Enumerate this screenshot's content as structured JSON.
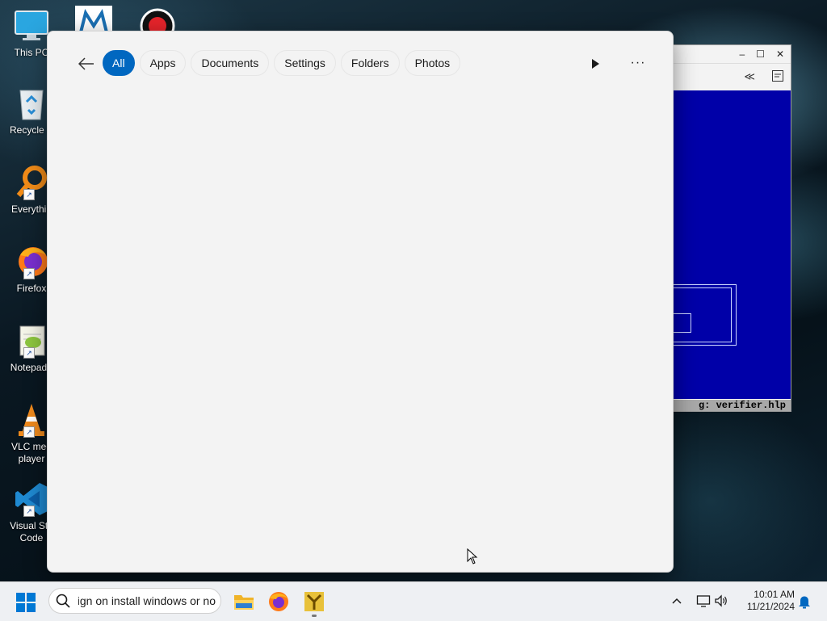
{
  "desktop": {
    "icons": [
      {
        "label": "This PC"
      },
      {
        "label": "Recycle B"
      },
      {
        "label": "Everythin"
      },
      {
        "label": "Firefox"
      },
      {
        "label": "Notepad+"
      },
      {
        "label_line1": "VLC med",
        "label_line2": "player"
      },
      {
        "label_line1": "Visual Stu",
        "label_line2": "Code"
      }
    ]
  },
  "background_window": {
    "minimize": "–",
    "maximize": "☐",
    "close": "✕",
    "status_text": "g: verifier.hlp"
  },
  "search_panel": {
    "filters": [
      {
        "label": "All",
        "active": true
      },
      {
        "label": "Apps"
      },
      {
        "label": "Documents"
      },
      {
        "label": "Settings"
      },
      {
        "label": "Folders"
      },
      {
        "label": "Photos"
      }
    ],
    "more_label": "···"
  },
  "taskbar": {
    "search_value": "uninstall sign on install windows or no",
    "clock_time": "10:01 AM",
    "clock_date": "11/21/2024"
  },
  "colors": {
    "accent": "#0067c0",
    "console_blue": "#0000a8"
  }
}
